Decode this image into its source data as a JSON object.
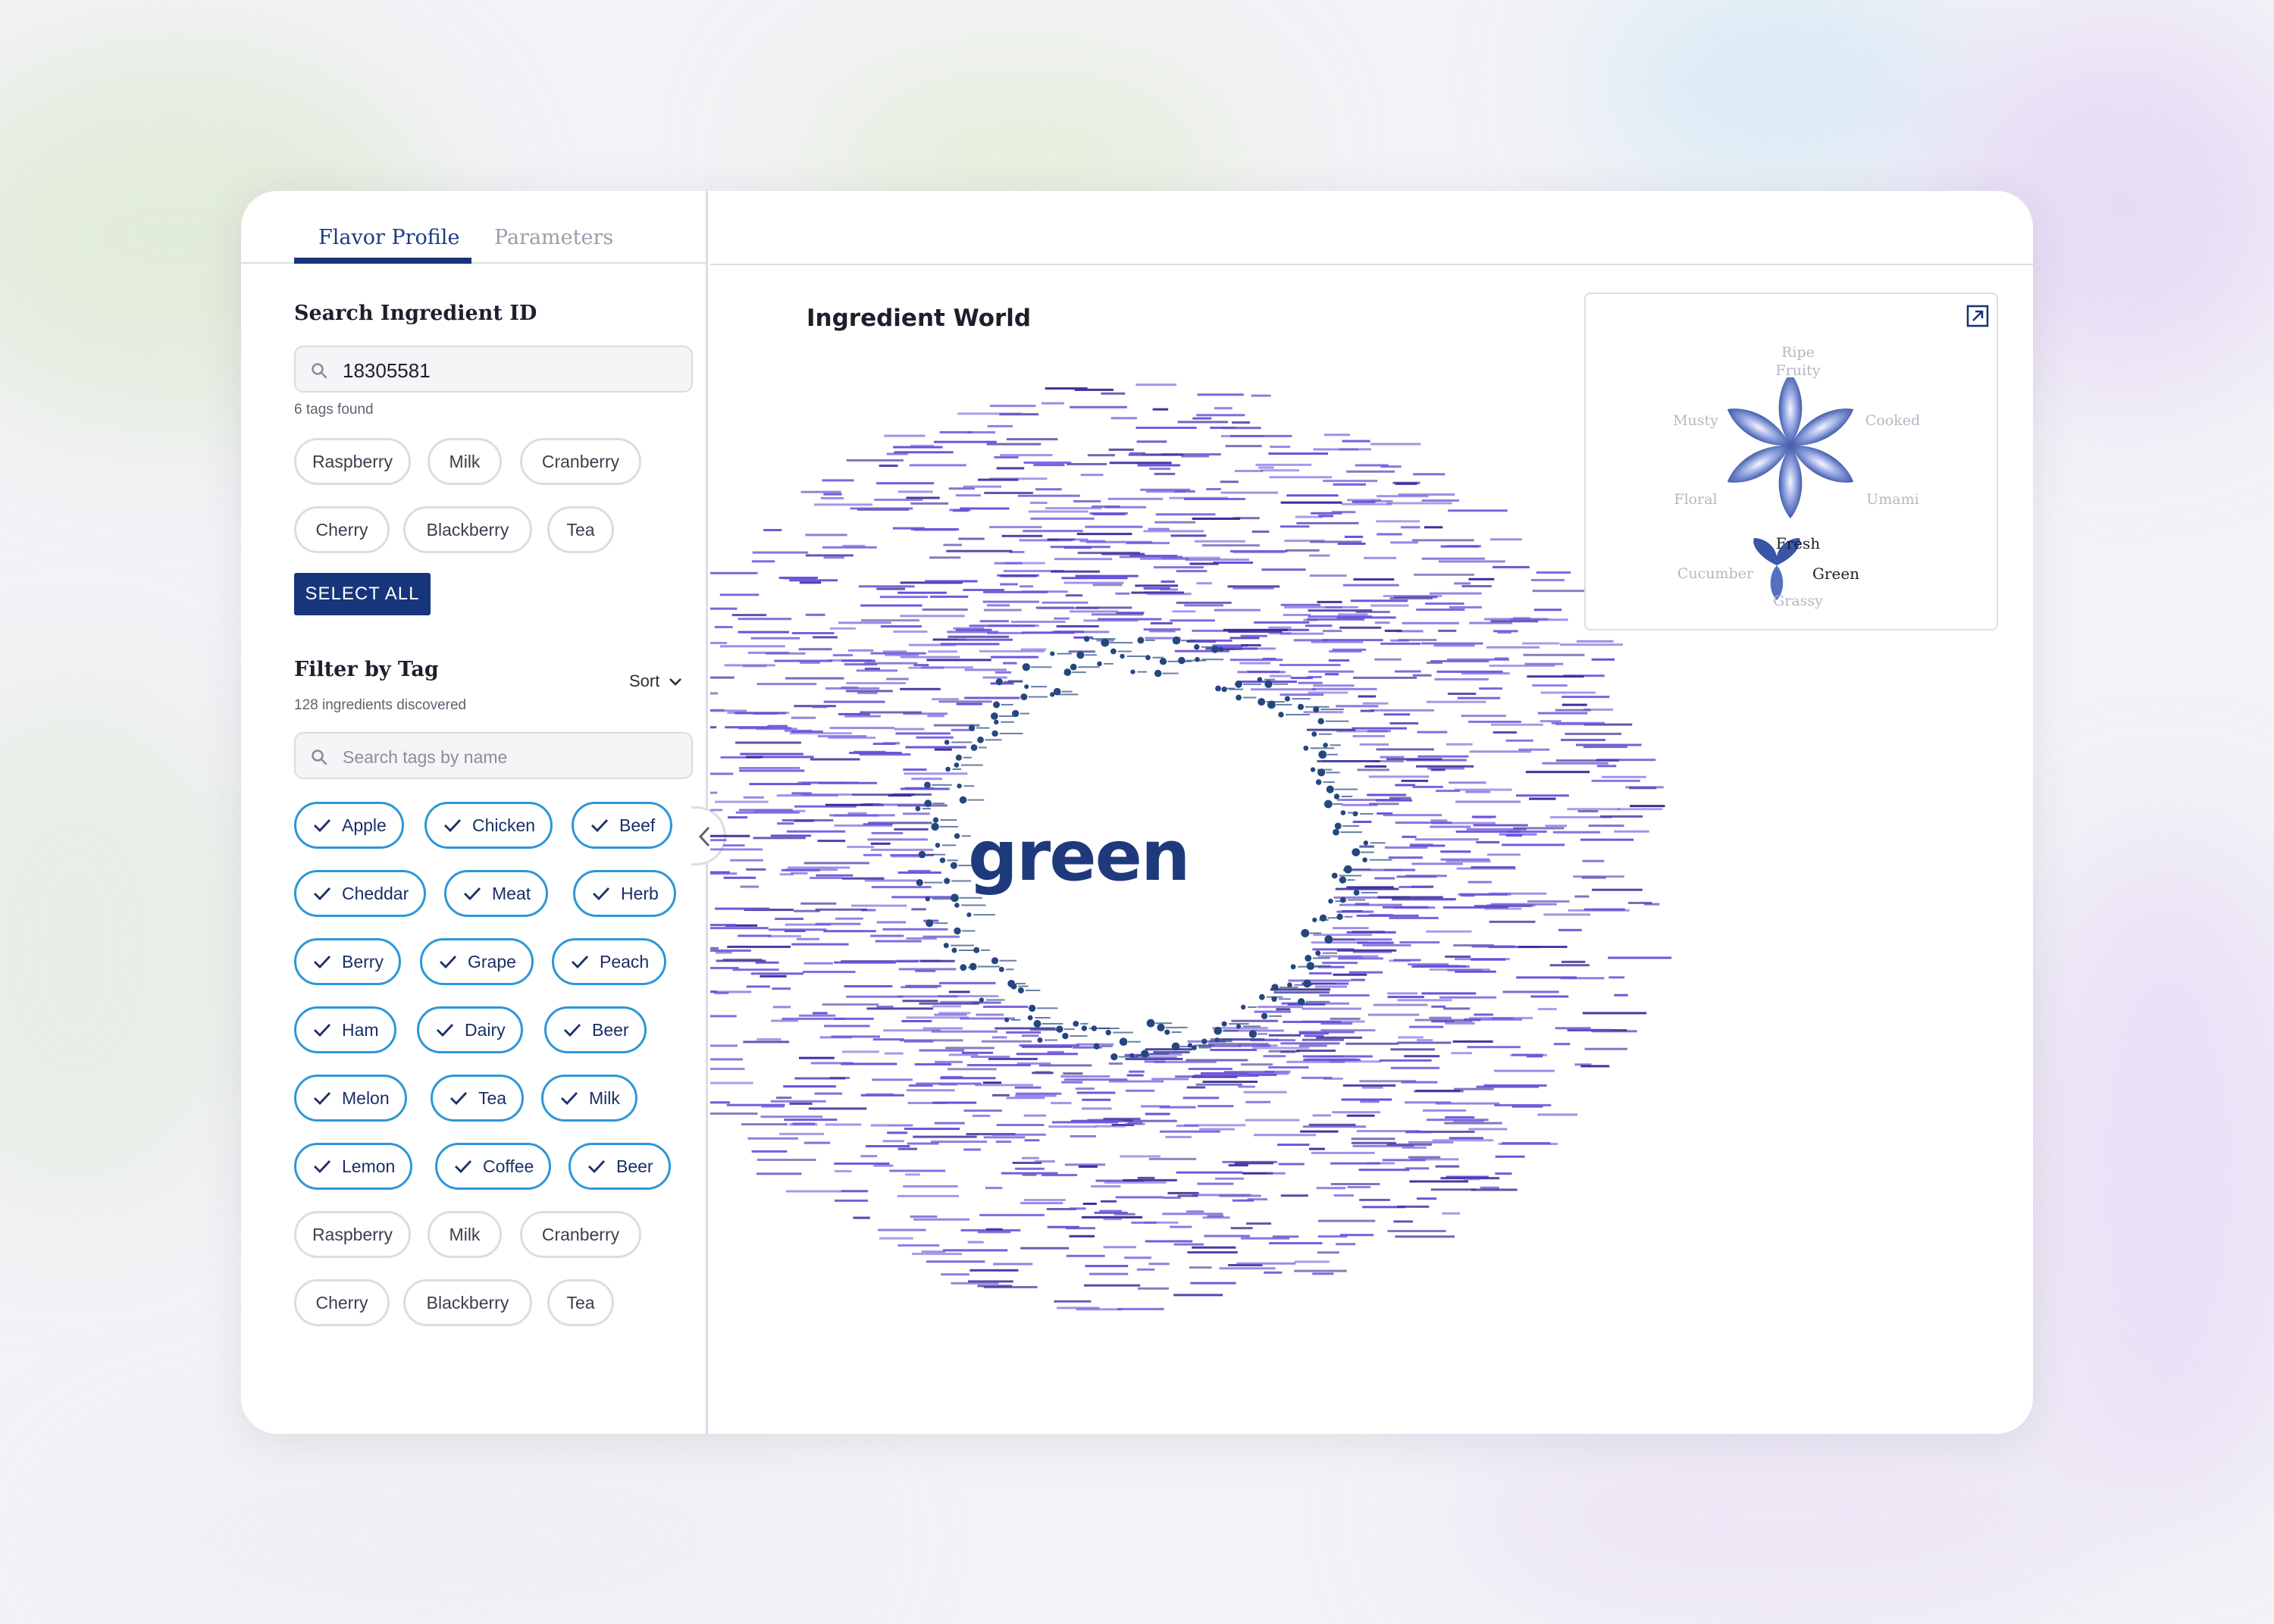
{
  "sidebar": {
    "tabs": [
      {
        "label": "Flavor Profile",
        "active": true
      },
      {
        "label": "Parameters",
        "active": false
      }
    ],
    "search": {
      "title": "Search Ingredient ID",
      "value": "18305581",
      "result_note": "6 tags found",
      "tags": [
        "Raspberry",
        "Milk",
        "Cranberry",
        "Cherry",
        "Blackberry",
        "Tea"
      ],
      "select_all_label": "SELECT ALL"
    },
    "filter": {
      "title": "Filter by Tag",
      "note": "128 ingredients discovered",
      "sort_label": "Sort",
      "search_placeholder": "Search tags by name",
      "selected_tags": [
        "Apple",
        "Chicken",
        "Beef",
        "Cheddar",
        "Meat",
        "Herb",
        "Berry",
        "Grape",
        "Peach",
        "Ham",
        "Dairy",
        "Beer",
        "Melon",
        "Tea",
        "Milk",
        "Lemon",
        "Coffee",
        "Beer"
      ],
      "unselected_tags": [
        "Raspberry",
        "Milk",
        "Cranberry",
        "Cherry",
        "Blackberry",
        "Tea"
      ]
    }
  },
  "main": {
    "title": "Ingredient World",
    "logo_text": "green",
    "view_icons": [
      "table-icon",
      "network-graph-icon"
    ],
    "flavor_wheel": {
      "labels": [
        "Ripe",
        "Fruity",
        "Cooked",
        "Umami",
        "Green",
        "Grassy",
        "Cucumber",
        "Floral",
        "Musty",
        "Fresh"
      ],
      "highlighted": [
        "Fresh",
        "Green"
      ]
    }
  },
  "colors": {
    "brand_navy": "#17357b",
    "chip_border": "#2d96d8",
    "graph_purple": "#6a4fd8",
    "graph_inner": "#24477f"
  }
}
